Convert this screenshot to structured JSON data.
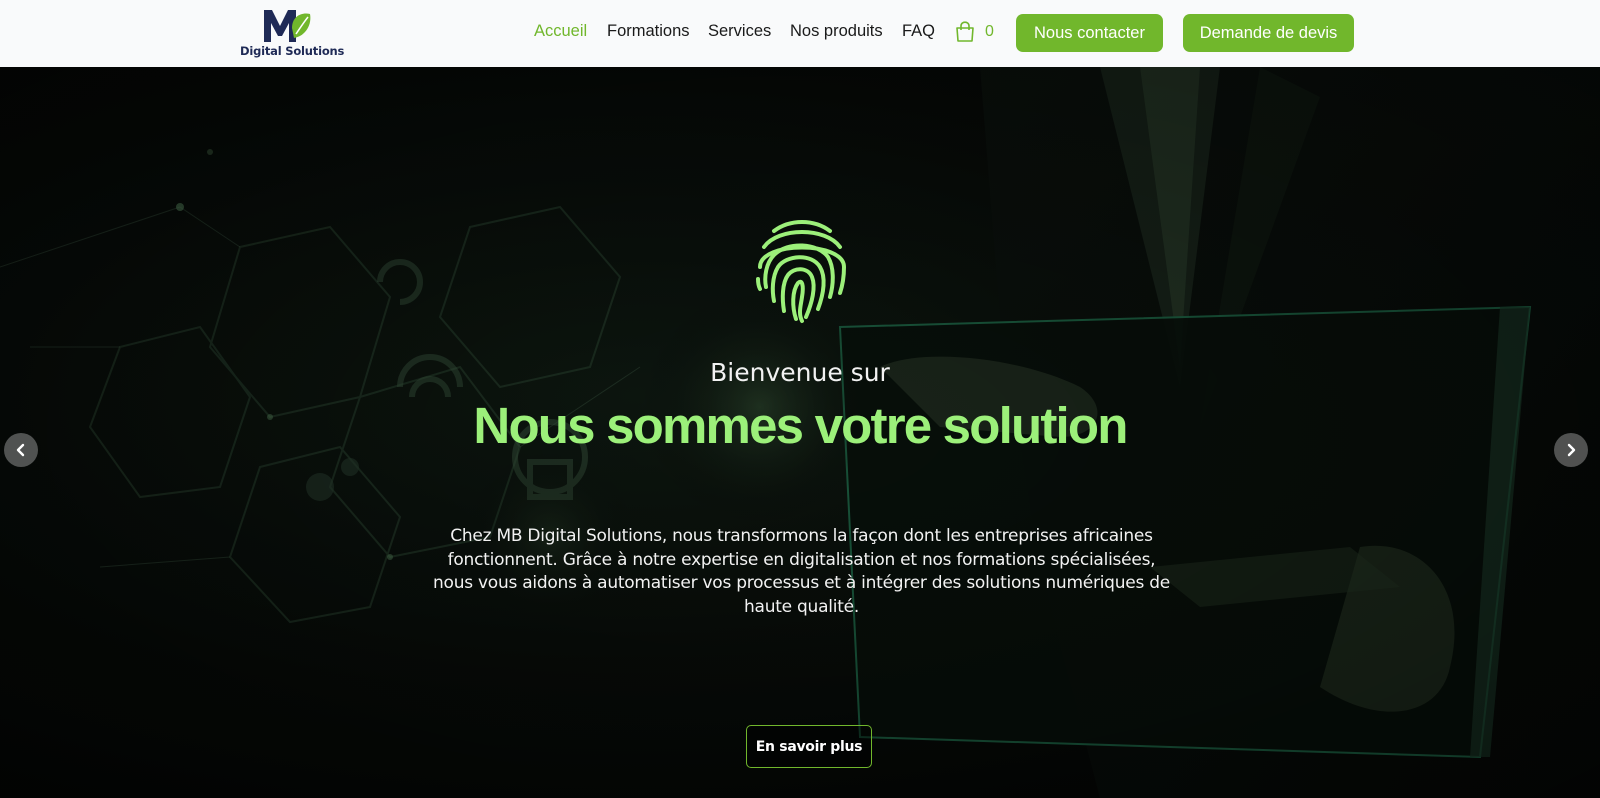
{
  "brand": {
    "logo_text": "Digital Solutions",
    "primary_color": "#71b72c",
    "headline_color": "#9cf07a",
    "logo_color": "#1f2a56"
  },
  "nav": {
    "items": [
      {
        "label": "Accueil",
        "active": true
      },
      {
        "label": "Formations",
        "active": false
      },
      {
        "label": "Services",
        "active": false
      },
      {
        "label": "Nos produits",
        "active": false
      },
      {
        "label": "FAQ",
        "active": false
      }
    ],
    "cart_icon": "shopping-bag-icon",
    "cart_count": "0",
    "contact_label": "Nous contacter",
    "quote_label": "Demande de devis"
  },
  "hero": {
    "icon": "fingerprint-icon",
    "welcome": "Bienvenue sur",
    "headline": "Nous sommes votre solution",
    "description": "Chez MB Digital Solutions, nous transformons la façon dont les entreprises africaines fonctionnent. Grâce à notre expertise en digitalisation et nos formations spécialisées, nous vous aidons à automatiser vos processus et à intégrer des solutions numériques de haute qualité.",
    "cta_label": "En savoir plus",
    "prev_icon": "chevron-left-icon",
    "next_icon": "chevron-right-icon"
  }
}
